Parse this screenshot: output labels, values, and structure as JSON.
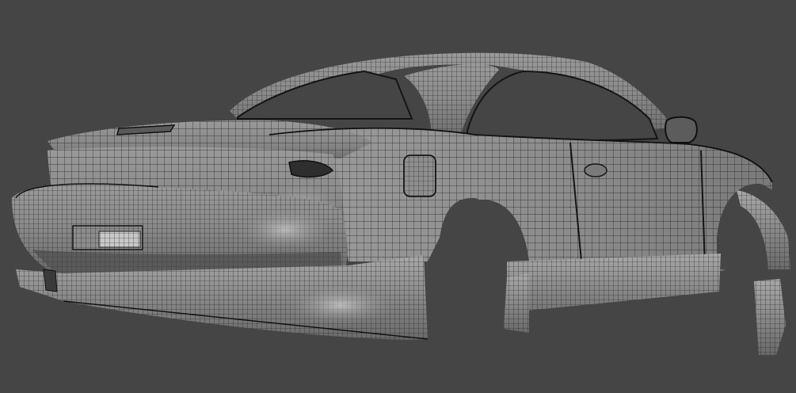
{
  "viewport": {
    "background_color": "#454545",
    "mesh_fill_color": "#8a8a8a",
    "mesh_highlight_color": "#d0d0d0",
    "wire_color": "#1e1e1e",
    "render_style": "wireframe-on-shaded",
    "subject": "car-body-mesh"
  }
}
